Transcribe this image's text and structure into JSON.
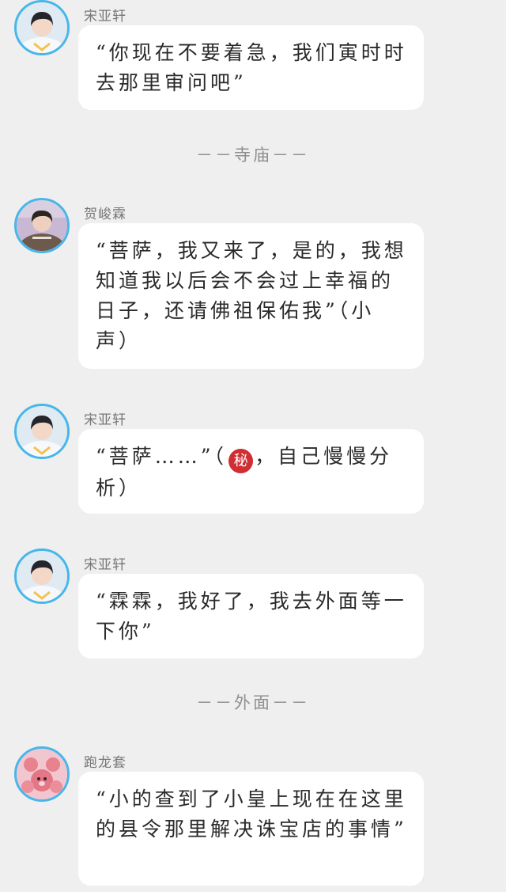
{
  "colors": {
    "background": "#efefef",
    "bubble": "#ffffff",
    "avatar_ring": "#47b6ea",
    "name_text": "#777777",
    "divider_text": "#8f8f8f",
    "emoji_seal": "#cf2e33"
  },
  "messages": [
    {
      "sender": "宋亚轩",
      "avatar_icon": "boy-white-shirt-avatar",
      "text": "“你现在不要着急，我们寅时时去那里审问吧”"
    },
    {
      "sender": "贺峻霖",
      "avatar_icon": "boy-brown-sweatshirt-avatar",
      "text": "“菩萨，我又来了，是的，我想知道我以后会不会过上幸福的日子，还请佛祖保佑我”（小声）"
    },
    {
      "sender": "宋亚轩",
      "avatar_icon": "boy-white-shirt-avatar",
      "text_before": "“菩萨……”（",
      "emoji": "秘",
      "emoji_icon": "secret-emoji-icon",
      "text_after": "，自己慢慢分析）"
    },
    {
      "sender": "宋亚轩",
      "avatar_icon": "boy-white-shirt-avatar",
      "text": "“霖霖，我好了，我去外面等一下你”"
    },
    {
      "sender": "跑龙套",
      "avatar_icon": "pink-bears-avatar",
      "text": "“小的查到了小皇上现在在这里的县令那里解决诛宝店的事情”"
    }
  ],
  "dividers": [
    {
      "text": "－－寺庙－－"
    },
    {
      "text": "－－外面－－"
    }
  ]
}
